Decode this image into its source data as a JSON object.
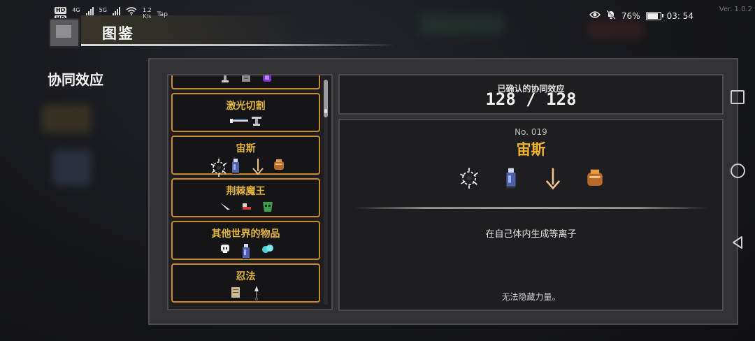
{
  "status_bar": {
    "sim1": "HD",
    "sim1_net": "4G",
    "sim2_net": "5G",
    "speed_value": "1.2",
    "speed_unit": "K/s",
    "tap": "Tap",
    "battery": "76%",
    "time": "03: 54",
    "version": "Ver. 1.0.2"
  },
  "header": {
    "title": "图鉴"
  },
  "section": {
    "title": "协同效应"
  },
  "synergy_list": [
    {
      "name": "",
      "items": [
        "turret-icon",
        "box-icon",
        "purple-gem-icon"
      ],
      "cut": true
    },
    {
      "name": "激光切割",
      "items": [
        "laser-beam-icon",
        "turret-icon"
      ]
    },
    {
      "name": "宙斯",
      "items": [
        "plasma-orb-icon",
        "bottle-icon",
        "arrow-icon",
        "bag-icon"
      ]
    },
    {
      "name": "荆棘魔王",
      "items": [
        "horn-icon",
        "shoe-icon",
        "green-mask-icon"
      ]
    },
    {
      "name": "其他世界的物品",
      "items": [
        "skull-icon",
        "bottle-icon",
        "cyan-orb-icon"
      ]
    },
    {
      "name": "忍法",
      "items": [
        "scroll-icon",
        "kunai-icon"
      ]
    }
  ],
  "confirmed": {
    "label": "已确认的协同效应",
    "count": "128 / 128"
  },
  "detail": {
    "number": "No. 019",
    "name": "宙斯",
    "items": [
      "plasma-orb-icon",
      "bottle-icon",
      "arrow-icon",
      "bag-icon"
    ],
    "description": "在自己体内生成等离子",
    "flavor": "无法隐藏力量。"
  },
  "colors": {
    "accent_gold": "#e2b53c",
    "card_border": "#c98a2a",
    "panel_bg": "#323236"
  }
}
